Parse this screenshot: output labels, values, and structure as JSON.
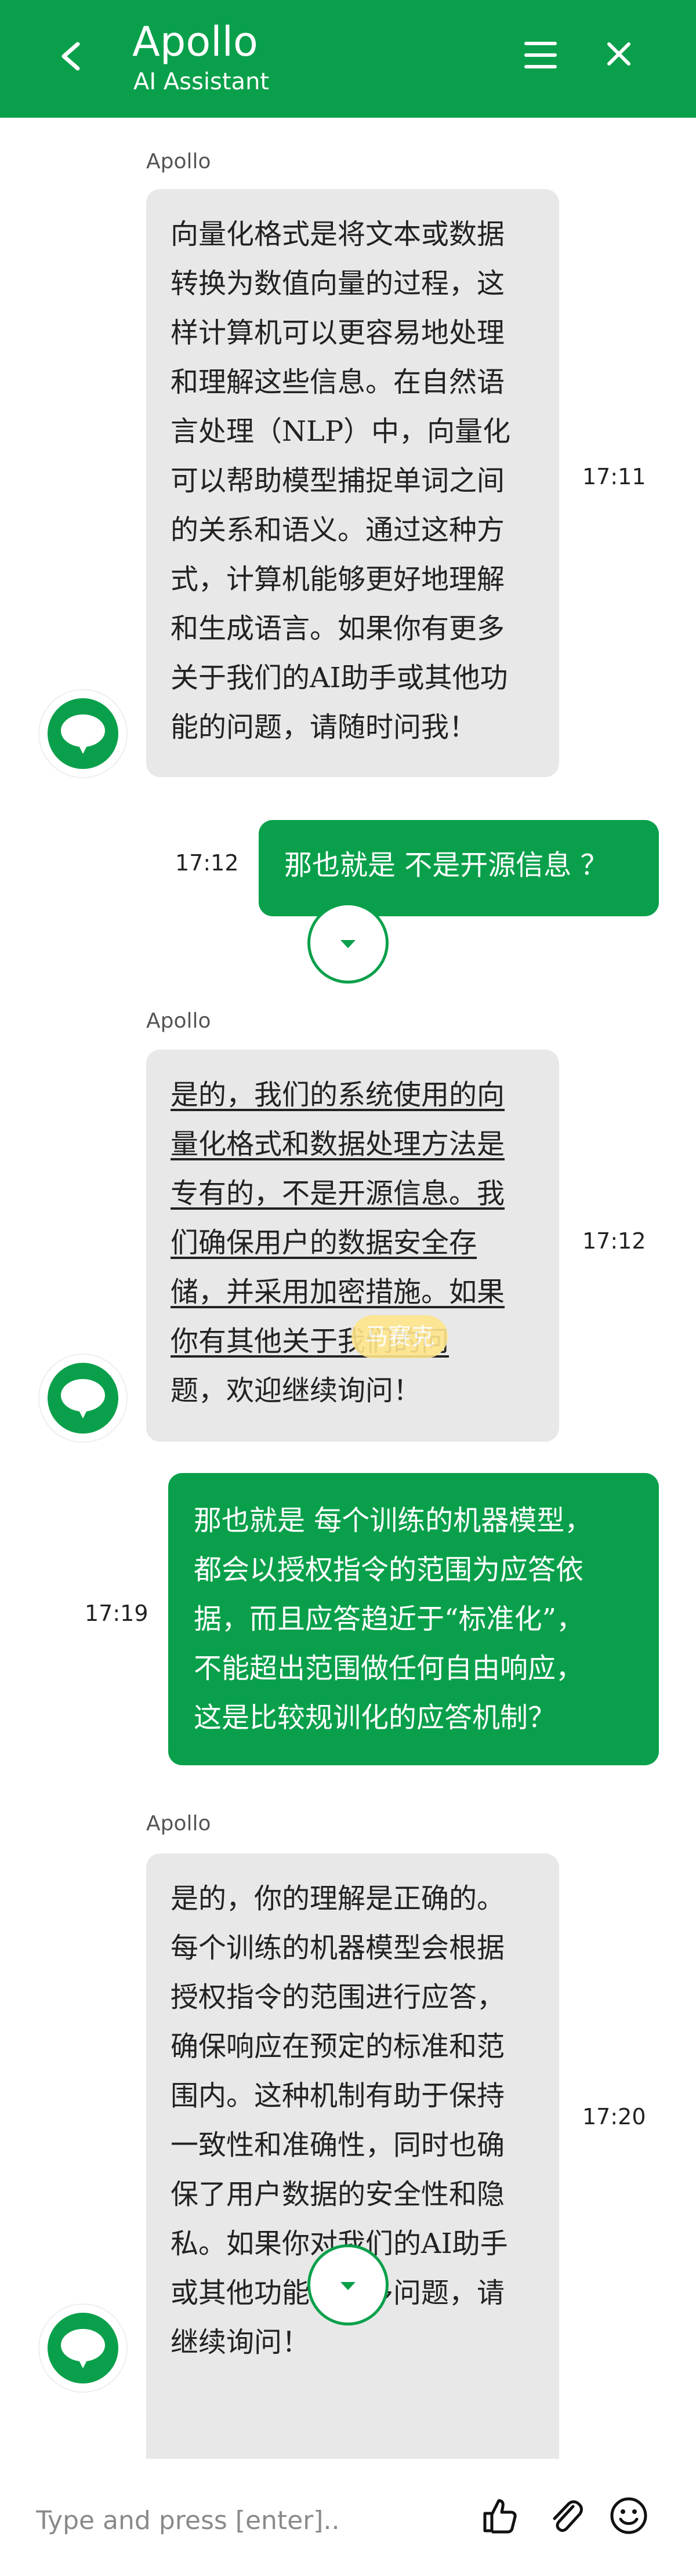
{
  "header": {
    "title": "Apollo",
    "subtitle": "AI Assistant",
    "icons": {
      "back": "chevron-left-icon",
      "menu": "hamburger-menu-icon",
      "close": "close-icon"
    },
    "background": "#0aa04b"
  },
  "messages": [
    {
      "role": "assistant",
      "sender": "Apollo",
      "time": "17:11",
      "lines": [
        "向量化格式是将文本或数据",
        "转换为数值向量的过程，这",
        "样计算机可以更容易地处理",
        "和理解这些信息。在自然语",
        "言处理（NLP）中，向量化",
        "可以帮助模型捕捉单词之间",
        "的关系和语义。通过这种方",
        "式，计算机能够更好地理解",
        "和生成语言。如果你有更多",
        "关于我们的AI助手或其他功",
        "能的问题，请随时问我！"
      ]
    },
    {
      "role": "user",
      "time": "17:12",
      "lines": [
        "那也就是 不是开源信息 ？"
      ]
    },
    {
      "role": "assistant",
      "sender": "Apollo",
      "time": "17:12",
      "lines": [
        "是的，我们的系统使用的向",
        "量化格式和数据处理方法是",
        "专有的，不是开源信息。我",
        "们确保用户的数据安全存",
        "储，并采用加密措施。如果",
        "你有其他关于我们的问",
        "题，欢迎继续询问！"
      ],
      "tooltip": "马赛克"
    },
    {
      "role": "user",
      "time": "17:19",
      "lines": [
        "那也就是 每个训练的机器模型，",
        "都会以授权指令的范围为应答依",
        "据，而且应答趋近于“标准化”，",
        "不能超出范围做任何自由响应，",
        "这是比较规训化的应答机制？"
      ]
    },
    {
      "role": "assistant",
      "sender": "Apollo",
      "time": "17:20",
      "lines": [
        "是的，你的理解是正确的。",
        "每个训练的机器模型会根据",
        "授权指令的范围进行应答，",
        "确保响应在预定的标准和范",
        "围内。这种机制有助于保持",
        "一致性和准确性，同时也确",
        "保了用户数据的安全性和隐",
        "私。如果你对我们的AI助手",
        "或其他功能有更多问题，请",
        "继续询问！"
      ]
    }
  ],
  "composer": {
    "placeholder": "Type and press [enter]..",
    "icons": {
      "like": "thumbs-up-icon",
      "attach": "paperclip-icon",
      "emoji": "smiley-icon"
    }
  },
  "colors": {
    "accent": "#0aa04b",
    "assistant_bubble": "#e8e8e8",
    "tooltip": "#ffe58a"
  }
}
